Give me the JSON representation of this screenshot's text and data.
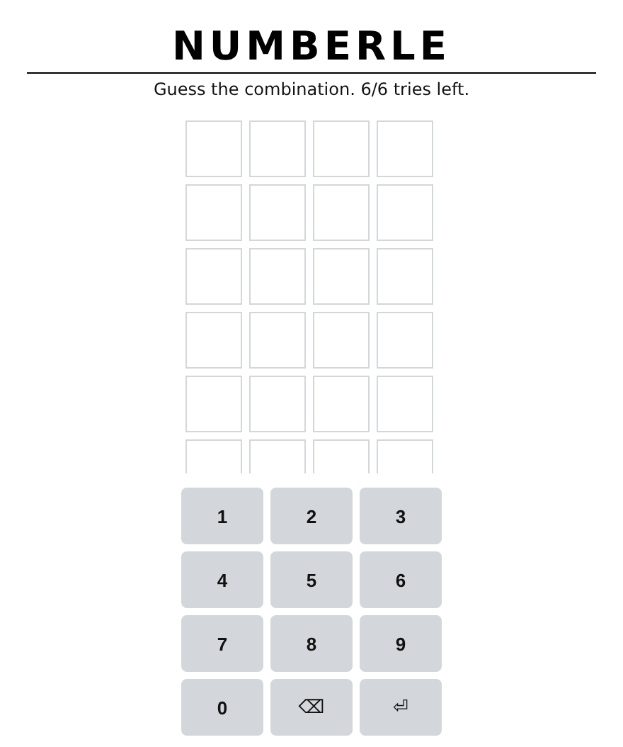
{
  "title": "NUMBERLE",
  "subtitle": "Guess the combination. 6/6 tries left.",
  "keypad": [
    {
      "label": "1",
      "kind": "digit"
    },
    {
      "label": "2",
      "kind": "digit"
    },
    {
      "label": "3",
      "kind": "digit"
    },
    {
      "label": "4",
      "kind": "digit"
    },
    {
      "label": "5",
      "kind": "digit"
    },
    {
      "label": "6",
      "kind": "digit"
    },
    {
      "label": "7",
      "kind": "digit"
    },
    {
      "label": "8",
      "kind": "digit"
    },
    {
      "label": "9",
      "kind": "digit"
    },
    {
      "label": "0",
      "kind": "digit"
    },
    {
      "label": "⌫",
      "kind": "delete"
    },
    {
      "label": "⏎",
      "kind": "enter"
    }
  ]
}
